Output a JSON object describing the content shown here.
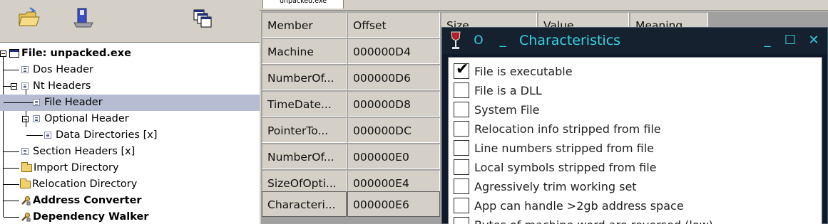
{
  "toolbar": {
    "icons": [
      "open-folder-icon",
      "save-disk-icon",
      "windows-icon"
    ]
  },
  "tree": {
    "root": "File: unpacked.exe",
    "dos_header": "Dos Header",
    "nt_headers": "Nt Headers",
    "file_header": "File Header",
    "optional_header": "Optional Header",
    "data_directories": "Data Directories [x]",
    "section_headers": "Section Headers [x]",
    "import_directory": "Import Directory",
    "relocation_directory": "Relocation Directory",
    "address_converter": "Address Converter",
    "dependency_walker": "Dependency Walker",
    "selected": "File Header"
  },
  "tab": {
    "label": "unpacked.exe"
  },
  "table": {
    "headers": [
      "Member",
      "Offset",
      "Size",
      "Value",
      "Meaning"
    ],
    "rows": [
      {
        "member": "Machine",
        "offset": "000000D4"
      },
      {
        "member": "NumberOf...",
        "offset": "000000D6"
      },
      {
        "member": "TimeDate...",
        "offset": "000000D8"
      },
      {
        "member": "PointerTo...",
        "offset": "000000DC"
      },
      {
        "member": "NumberOf...",
        "offset": "000000E0"
      },
      {
        "member": "SizeOfOpti...",
        "offset": "000000E4"
      },
      {
        "member": "Characteri...",
        "offset": "000000E6"
      }
    ],
    "selected_row": "Characteri..."
  },
  "dialog": {
    "title": "Characteristics",
    "buttons": {
      "o": "O",
      "dash": "_",
      "minimize": "_",
      "maximize": "☐",
      "close": "✕"
    },
    "flags": [
      {
        "label": "File is executable",
        "checked": true
      },
      {
        "label": "File is a DLL",
        "checked": false
      },
      {
        "label": "System File",
        "checked": false
      },
      {
        "label": "Relocation info stripped from file",
        "checked": false
      },
      {
        "label": "Line numbers stripped from file",
        "checked": false
      },
      {
        "label": "Local symbols stripped from file",
        "checked": false
      },
      {
        "label": "Agressively trim working set",
        "checked": false
      },
      {
        "label": "App can handle >2gb address space",
        "checked": false
      },
      {
        "label": "Bytes of machine word are reversed (low)",
        "checked": false
      }
    ],
    "check_glyph": "✔"
  },
  "colors": {
    "accent": "#35d4e4",
    "dialog_bg": "#0e1a2a",
    "selection": "#b6bdd2",
    "panel": "#d4d0c8"
  }
}
